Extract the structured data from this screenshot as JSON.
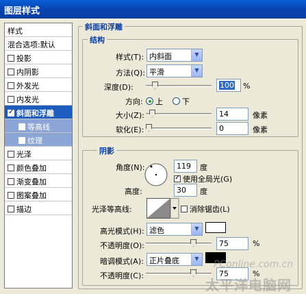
{
  "window": {
    "title": "图层样式"
  },
  "left_panel": {
    "header": "样式",
    "blend_item": "混合选项:默认",
    "items": [
      {
        "label": "投影",
        "checked": false
      },
      {
        "label": "内阴影",
        "checked": false
      },
      {
        "label": "外发光",
        "checked": false
      },
      {
        "label": "内发光",
        "checked": false
      },
      {
        "label": "斜面和浮雕",
        "checked": true
      },
      {
        "label": "等高线",
        "checked": false
      },
      {
        "label": "纹理",
        "checked": false
      },
      {
        "label": "光泽",
        "checked": false
      },
      {
        "label": "颜色叠加",
        "checked": false
      },
      {
        "label": "渐变叠加",
        "checked": false
      },
      {
        "label": "图案叠加",
        "checked": false
      },
      {
        "label": "描边",
        "checked": false
      }
    ]
  },
  "bevel": {
    "section_title": "斜面和浮雕",
    "structure": {
      "title": "结构",
      "style_label": "样式(T):",
      "style_value": "内斜面",
      "technique_label": "方法(Q):",
      "technique_value": "平滑",
      "depth_label": "深度(D):",
      "depth_value": "100",
      "depth_unit": "%",
      "direction_label": "方向:",
      "direction_up": "上",
      "direction_down": "下",
      "size_label": "大小(Z):",
      "size_value": "14",
      "size_unit": "像素",
      "soften_label": "软化(E):",
      "soften_value": "0",
      "soften_unit": "像素"
    },
    "shading": {
      "title": "阴影",
      "angle_label": "角度(N):",
      "angle_value": "119",
      "angle_unit": "度",
      "global_light_label": "使用全局光(G)",
      "global_light_checked": true,
      "altitude_label": "高度:",
      "altitude_value": "30",
      "altitude_unit": "度",
      "gloss_contour_label": "光泽等高线:",
      "anti_alias_label": "消除锯齿(L)",
      "highlight_mode_label": "高光模式(H):",
      "highlight_mode_value": "滤色",
      "highlight_color": "#ffffff",
      "highlight_opacity_label": "不透明度(O):",
      "highlight_opacity_value": "75",
      "highlight_opacity_unit": "%",
      "shadow_mode_label": "暗调模式(A):",
      "shadow_mode_value": "正片叠底",
      "shadow_color": "#000000",
      "shadow_opacity_label": "不透明度(C):",
      "shadow_opacity_value": "75",
      "shadow_opacity_unit": "%"
    }
  },
  "sliders": {
    "depth_fraction": 0.1,
    "size_fraction": 0.06,
    "soften_fraction": 0.0,
    "highlight_opacity_fraction": 0.75,
    "shadow_opacity_fraction": 0.75
  },
  "watermark": {
    "line1": "PConline.com.cn",
    "line2": "太平洋电脑网"
  }
}
